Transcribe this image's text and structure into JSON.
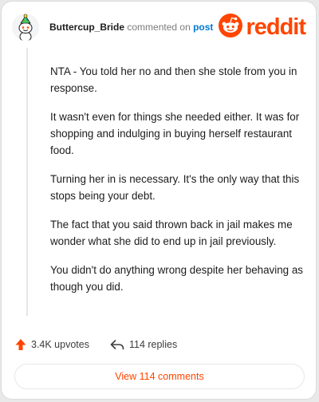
{
  "header": {
    "username": "Buttercup_Bride",
    "commented_on": "commented on",
    "post_link": "post",
    "logo_text": "reddit",
    "avatar_icon": "snoo-avatar-icon",
    "logo_icon": "reddit-snoo-icon"
  },
  "comment": {
    "paragraphs": [
      "NTA - You told her no and then she stole from you in response.",
      "It wasn't even for things she needed either. It was for shopping and indulging in buying herself restaurant food.",
      "Turning her in is necessary. It's the only way that this stops being your debt.",
      "The fact that you said thrown back in jail makes me wonder what she did to end up in jail previously.",
      "You didn't do anything wrong despite her behaving as though you did."
    ]
  },
  "actions": {
    "upvotes_label": "3.4K upvotes",
    "replies_label": "114 replies",
    "upvote_icon": "upvote-arrow-icon",
    "reply_icon": "reply-arrow-icon"
  },
  "footer": {
    "view_comments_label": "View 114 comments"
  },
  "colors": {
    "brand": "#ff4500",
    "link": "#0079d3",
    "text": "#1c1c1c",
    "muted": "#7c7c7c"
  }
}
